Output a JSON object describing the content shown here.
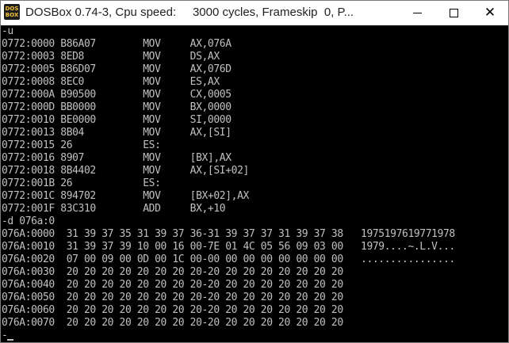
{
  "window": {
    "title": "DOSBox 0.74-3, Cpu speed:     3000 cycles, Frameskip  0, P...",
    "icon_text_top": "DOS",
    "icon_text_bottom": "BOX"
  },
  "terminal": {
    "lines": [
      "-u",
      "0772:0000 B86A07        MOV     AX,076A",
      "0772:0003 8ED8          MOV     DS,AX",
      "0772:0005 B86D07        MOV     AX,076D",
      "0772:0008 8EC0          MOV     ES,AX",
      "0772:000A B90500        MOV     CX,0005",
      "0772:000D BB0000        MOV     BX,0000",
      "0772:0010 BE0000        MOV     SI,0000",
      "0772:0013 8B04          MOV     AX,[SI]",
      "0772:0015 26            ES:",
      "0772:0016 8907          MOV     [BX],AX",
      "0772:0018 8B4402        MOV     AX,[SI+02]",
      "0772:001B 26            ES:",
      "0772:001C 894702        MOV     [BX+02],AX",
      "0772:001F 83C310        ADD     BX,+10",
      "-d 076a:0",
      "076A:0000  31 39 37 35 31 39 37 36-31 39 37 37 31 39 37 38   1975197619771978",
      "076A:0010  31 39 37 39 10 00 16 00-7E 01 4C 05 56 09 03 00   1979....~.L.V...",
      "076A:0020  07 00 09 00 0D 00 1C 00-00 00 00 00 00 00 00 00   ................",
      "076A:0030  20 20 20 20 20 20 20 20-20 20 20 20 20 20 20 20",
      "076A:0040  20 20 20 20 20 20 20 20-20 20 20 20 20 20 20 20",
      "076A:0050  20 20 20 20 20 20 20 20-20 20 20 20 20 20 20 20",
      "076A:0060  20 20 20 20 20 20 20 20-20 20 20 20 20 20 20 20",
      "076A:0070  20 20 20 20 20 20 20 20-20 20 20 20 20 20 20 20",
      "-"
    ]
  }
}
